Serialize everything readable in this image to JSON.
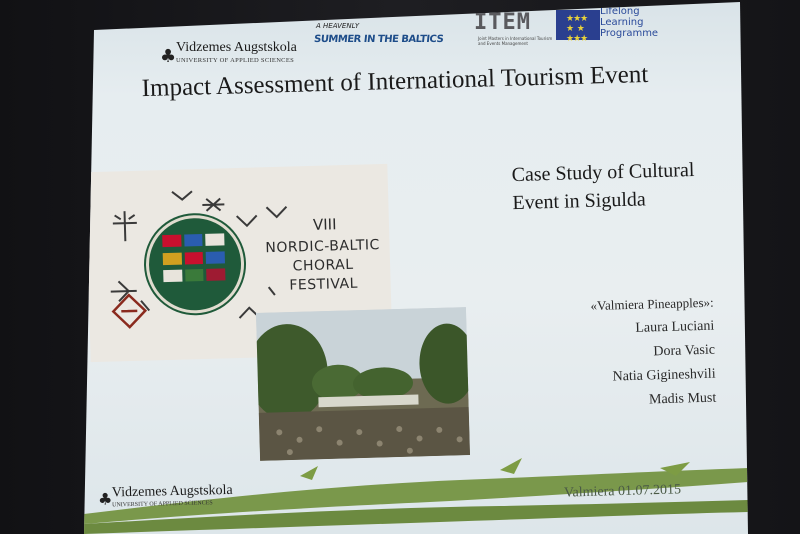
{
  "header_logos": {
    "school_name": "Vidzemes Augstskola",
    "school_sub": "UNIVERSITY OF APPLIED SCIENCES",
    "sib_top": "A HEAVENLY",
    "sib_main": "SUMMER IN THE BALTICS",
    "item_main": "ITEM",
    "item_sub": "Joint Masters in International Tourism and Events Management",
    "llp": "Lifelong Learning Programme"
  },
  "slide": {
    "title": "Impact Assessment of International Tourism Event",
    "case_study": "Case Study of Cultural Event in Sigulda",
    "group": "«Valmiera Pineapples»:",
    "authors": [
      "Laura Luciani",
      "Dora Vasic",
      "Natia Gigineshvili",
      "Madis Must"
    ]
  },
  "festival_cover": {
    "edition": "VIII",
    "name": "NORDIC-BALTIC CHORAL FESTIVAL"
  },
  "footer": {
    "school_name": "Vidzemes Augstskola",
    "school_sub": "UNIVERSITY OF APPLIED SCIENCES",
    "date": "Valmiera 01.07.2015"
  },
  "colors": {
    "screen": "#e6edf0",
    "grass_green": "#6f8f3a",
    "badge_green": "#1f5a3a",
    "eu_blue": "#2a3f8f"
  }
}
